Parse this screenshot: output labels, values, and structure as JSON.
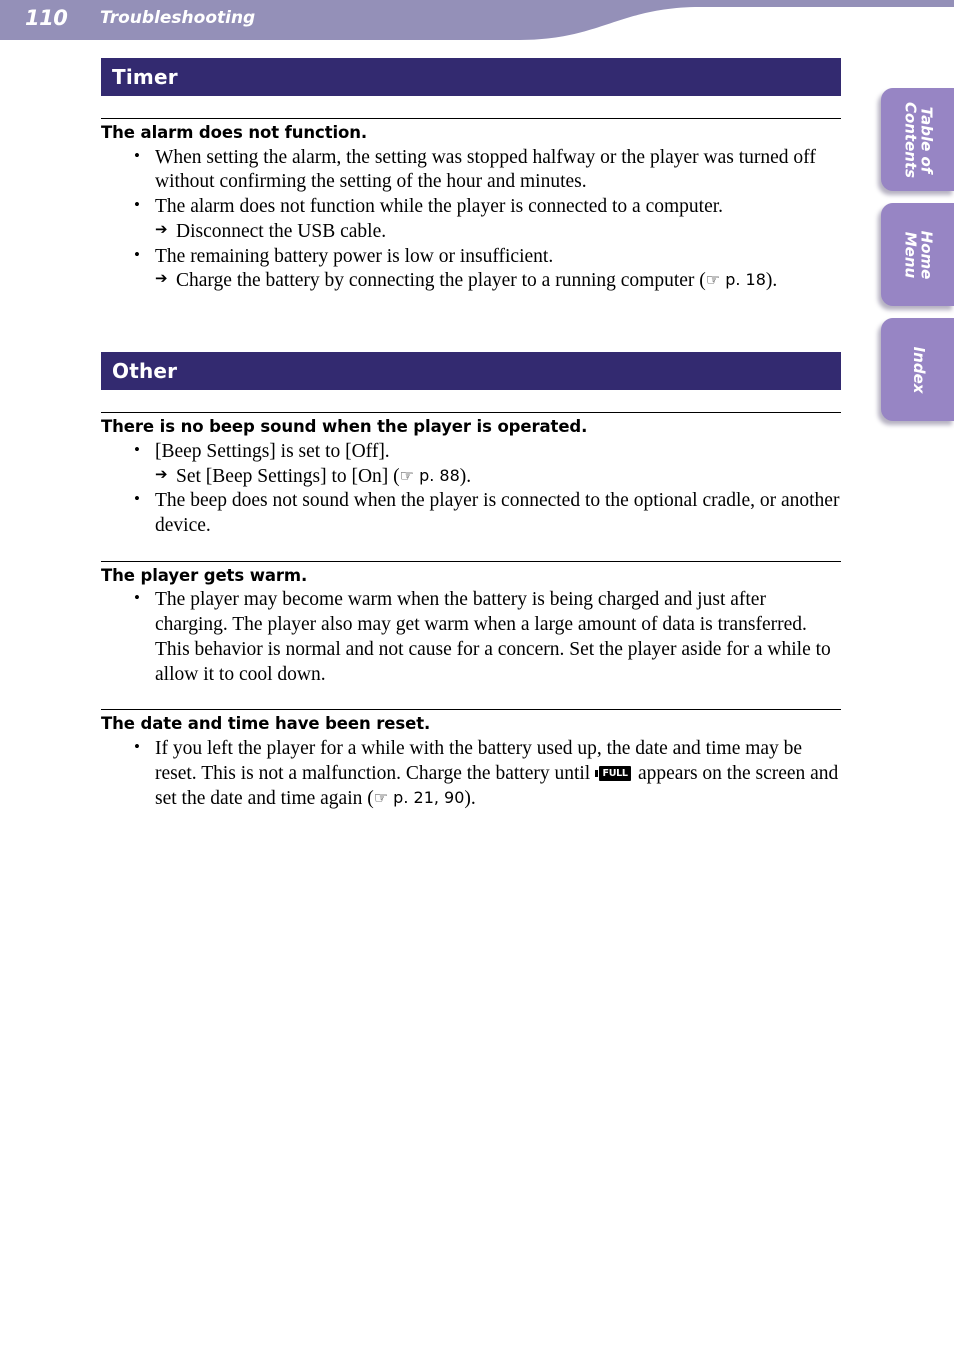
{
  "header": {
    "page_number": "110",
    "title": "Troubleshooting",
    "band_color": "#9490b8"
  },
  "side_tabs": [
    {
      "name": "table-of-contents",
      "label": "Table of\nContents",
      "line1": "Table of",
      "line2": "Contents"
    },
    {
      "name": "home-menu",
      "label": "Home\nMenu",
      "line1": "Home",
      "line2": "Menu"
    },
    {
      "name": "index",
      "label": "Index",
      "line1": "Index",
      "line2": ""
    }
  ],
  "tab_color": "#9785c4",
  "section_bar_color": "#332a70",
  "sections": [
    {
      "title": "Timer",
      "blocks": [
        {
          "heading": "The alarm does not function.",
          "items": [
            {
              "text": "When setting the alarm, the setting was stopped halfway or the player was turned off without confirming the setting of the hour and minutes.",
              "sub": []
            },
            {
              "text": "The alarm does not function while the player is connected to a computer.",
              "sub": [
                "Disconnect the USB cable."
              ]
            },
            {
              "text": "The remaining battery power is low or insufficient.",
              "sub_pre": "Charge the battery by connecting the player to a running computer (",
              "sub_ref": "☞ p. 18",
              "sub_post": ")."
            }
          ]
        }
      ]
    },
    {
      "title": "Other",
      "blocks": [
        {
          "heading": "There is no beep sound when the player is operated.",
          "items": [
            {
              "text": "[Beep Settings] is set to [Off].",
              "sub_pre": "Set [Beep Settings] to [On] (",
              "sub_ref": "☞ p. 88",
              "sub_post": ")."
            },
            {
              "text": "The beep does not sound when the player is connected to the optional cradle, or another device.",
              "sub": []
            }
          ]
        },
        {
          "heading": "The player gets warm.",
          "items": [
            {
              "text": "The player may become warm when the battery is being charged and just after charging. The player also may get warm when a large amount of data is transferred. This behavior is normal and not cause for a concern. Set the player aside for a while to allow it to cool down.",
              "sub": []
            }
          ]
        },
        {
          "heading": "The date and time have been reset.",
          "items": [
            {
              "text_part1": "If you left the player for a while with the battery used up, the date and time may be reset. This is not a malfunction. Charge the battery until ",
              "battery_icon_label": "FULL",
              "text_part2": " appears on the screen and set the date and time again (",
              "pageref": "☞ p. 21, 90",
              "text_part3": ")."
            }
          ]
        }
      ]
    }
  ]
}
